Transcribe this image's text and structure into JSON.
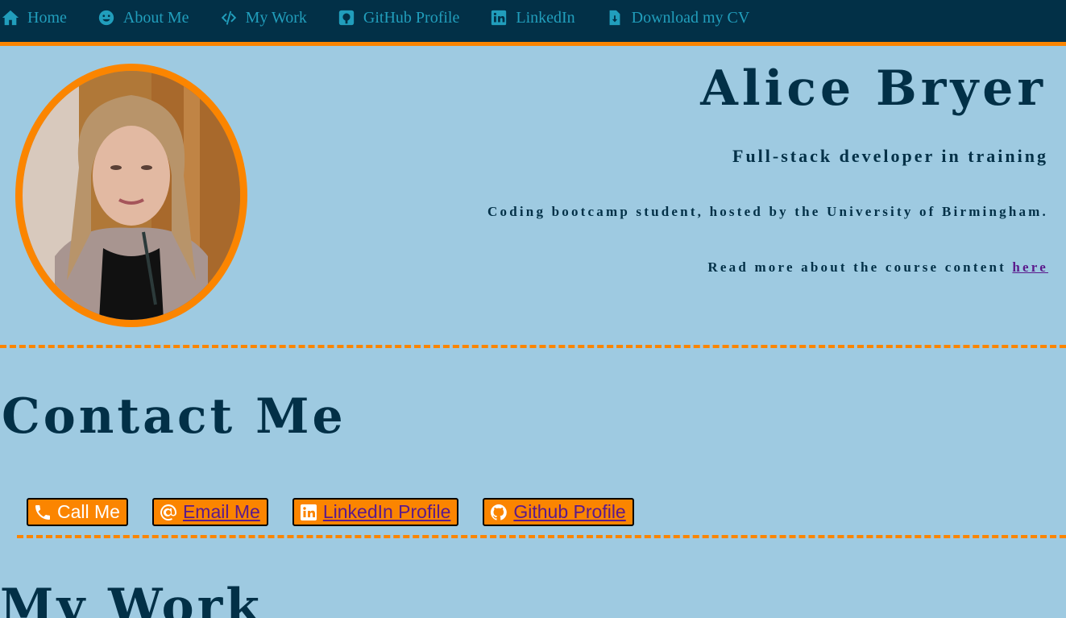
{
  "nav": {
    "items": [
      {
        "label": "Home",
        "icon": "home-icon"
      },
      {
        "label": "About Me",
        "icon": "smile-icon"
      },
      {
        "label": "My Work",
        "icon": "code-icon"
      },
      {
        "label": "GitHub Profile",
        "icon": "github-square-icon"
      },
      {
        "label": "LinkedIn",
        "icon": "linkedin-icon"
      },
      {
        "label": "Download my CV",
        "icon": "file-download-icon"
      }
    ]
  },
  "hero": {
    "name": "Alice Bryer",
    "subtitle": "Full-stack developer in training",
    "description": "Coding bootcamp student, hosted by the University of Birmingham.",
    "readmore_text": "Read more about the course content ",
    "readmore_link": "here"
  },
  "contact": {
    "title": "Contact Me",
    "buttons": [
      {
        "label": "Call Me",
        "icon": "phone-icon"
      },
      {
        "label": "Email Me",
        "icon": "at-icon"
      },
      {
        "label": "LinkedIn Profile",
        "icon": "linkedin-icon"
      },
      {
        "label": "Github Profile",
        "icon": "github-icon"
      }
    ]
  },
  "work": {
    "title": "My Work"
  },
  "colors": {
    "background": "#9ecae1",
    "nav_bg": "#023047",
    "accent": "#fb8500",
    "nav_text": "#219ebc",
    "visited_link": "#5b1a8c"
  }
}
